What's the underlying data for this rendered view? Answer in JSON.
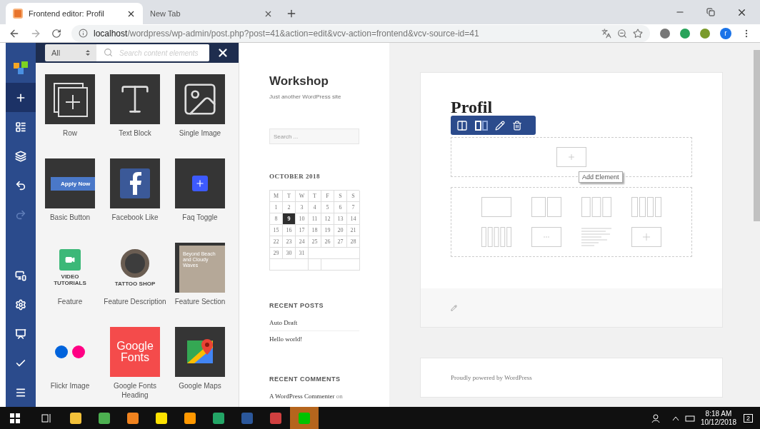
{
  "browser": {
    "tabs": [
      {
        "title": "Frontend editor: Profil",
        "selected": true
      },
      {
        "title": "New Tab",
        "selected": false
      }
    ],
    "url_host": "localhost",
    "url_path": "/wordpress/wp-admin/post.php?post=41&action=edit&vcv-action=frontend&vcv-source-id=41",
    "profile_initial": "r"
  },
  "editor_sidebar": {
    "items": [
      {
        "kind": "add",
        "selected": true,
        "disabled": false
      },
      {
        "kind": "layout",
        "selected": false,
        "disabled": false
      },
      {
        "kind": "layers",
        "selected": false,
        "disabled": false
      },
      {
        "kind": "undo",
        "selected": false,
        "disabled": false
      },
      {
        "kind": "redo",
        "selected": false,
        "disabled": true
      }
    ],
    "bottom_items": [
      {
        "kind": "devices",
        "selected": false,
        "disabled": false
      },
      {
        "kind": "settings",
        "selected": false,
        "disabled": false
      },
      {
        "kind": "hub",
        "selected": false,
        "disabled": false
      },
      {
        "kind": "publish",
        "selected": false,
        "disabled": false
      },
      {
        "kind": "menu",
        "selected": false,
        "disabled": false
      }
    ]
  },
  "panel": {
    "filter": "All",
    "search_placeholder": "Search content elements",
    "elements": [
      {
        "label": "Row",
        "kind": "row"
      },
      {
        "label": "Text Block",
        "kind": "text"
      },
      {
        "label": "Single Image",
        "kind": "image"
      },
      {
        "label": "Basic Button",
        "kind": "button",
        "thumb_text": "Apply Now"
      },
      {
        "label": "Facebook Like",
        "kind": "facebook"
      },
      {
        "label": "Faq Toggle",
        "kind": "faq"
      },
      {
        "label": "Feature",
        "kind": "feature",
        "thumb_text": "VIDEO TUTORIALS"
      },
      {
        "label": "Feature Description",
        "kind": "description",
        "thumb_text": "TATTOO SHOP"
      },
      {
        "label": "Feature Section",
        "kind": "section",
        "thumb_text": "Beyond Beach and Cloudy Waves"
      },
      {
        "label": "Flickr Image",
        "kind": "flickr"
      },
      {
        "label": "Google Fonts Heading",
        "kind": "fonts",
        "thumb_text": "Google Fonts"
      },
      {
        "label": "Google Maps",
        "kind": "maps"
      }
    ]
  },
  "site": {
    "title": "Workshop",
    "tagline": "Just another WordPress site",
    "search_placeholder": "Search ...",
    "calendar": {
      "title": "OCTOBER 2018",
      "weekdays": [
        "M",
        "T",
        "W",
        "T",
        "F",
        "S",
        "S"
      ],
      "days": [
        {
          "label": "1",
          "selected": false
        },
        {
          "label": "2",
          "selected": false
        },
        {
          "label": "3",
          "selected": false
        },
        {
          "label": "4",
          "selected": false
        },
        {
          "label": "5",
          "selected": false
        },
        {
          "label": "6",
          "selected": false
        },
        {
          "label": "7",
          "selected": false
        },
        {
          "label": "8",
          "selected": false
        },
        {
          "label": "9",
          "selected": true
        },
        {
          "label": "10",
          "selected": false
        },
        {
          "label": "11",
          "selected": false
        },
        {
          "label": "12",
          "selected": false
        },
        {
          "label": "13",
          "selected": false
        },
        {
          "label": "14",
          "selected": false
        },
        {
          "label": "15",
          "selected": false
        },
        {
          "label": "16",
          "selected": false
        },
        {
          "label": "17",
          "selected": false
        },
        {
          "label": "18",
          "selected": false
        },
        {
          "label": "19",
          "selected": false
        },
        {
          "label": "20",
          "selected": false
        },
        {
          "label": "21",
          "selected": false
        },
        {
          "label": "22",
          "selected": false
        },
        {
          "label": "23",
          "selected": false
        },
        {
          "label": "24",
          "selected": false
        },
        {
          "label": "25",
          "selected": false
        },
        {
          "label": "26",
          "selected": false
        },
        {
          "label": "27",
          "selected": false
        },
        {
          "label": "28",
          "selected": false
        },
        {
          "label": "29",
          "selected": false
        },
        {
          "label": "30",
          "selected": false
        },
        {
          "label": "31",
          "selected": false
        }
      ]
    },
    "recent_posts": {
      "title": "RECENT POSTS",
      "items": [
        "Auto Draft",
        "Hello world!"
      ]
    },
    "recent_comments": {
      "title": "RECENT COMMENTS",
      "items": [
        {
          "author": "A WordPress Commenter",
          "joiner": "on"
        }
      ]
    }
  },
  "page": {
    "title": "Profil",
    "tooltip": "Add Element",
    "footer": "Proudly powered by WordPress",
    "layouts": [
      {
        "kind": "one"
      },
      {
        "kind": "two"
      },
      {
        "kind": "three"
      },
      {
        "kind": "four"
      },
      {
        "kind": "five"
      },
      {
        "kind": "custom"
      },
      {
        "kind": "text"
      },
      {
        "kind": "add"
      }
    ]
  },
  "taskbar": {
    "apps": [
      {
        "kind": "explorer",
        "selected": false
      },
      {
        "kind": "chrome",
        "selected": false
      },
      {
        "kind": "media",
        "selected": false
      },
      {
        "kind": "notes",
        "selected": false
      },
      {
        "kind": "sublime",
        "selected": false
      },
      {
        "kind": "chat",
        "selected": false
      },
      {
        "kind": "word",
        "selected": false
      },
      {
        "kind": "paint",
        "selected": false
      },
      {
        "kind": "line",
        "selected": true
      }
    ],
    "time": "8:18 AM",
    "date": "10/12/2018",
    "notifications": "2"
  }
}
